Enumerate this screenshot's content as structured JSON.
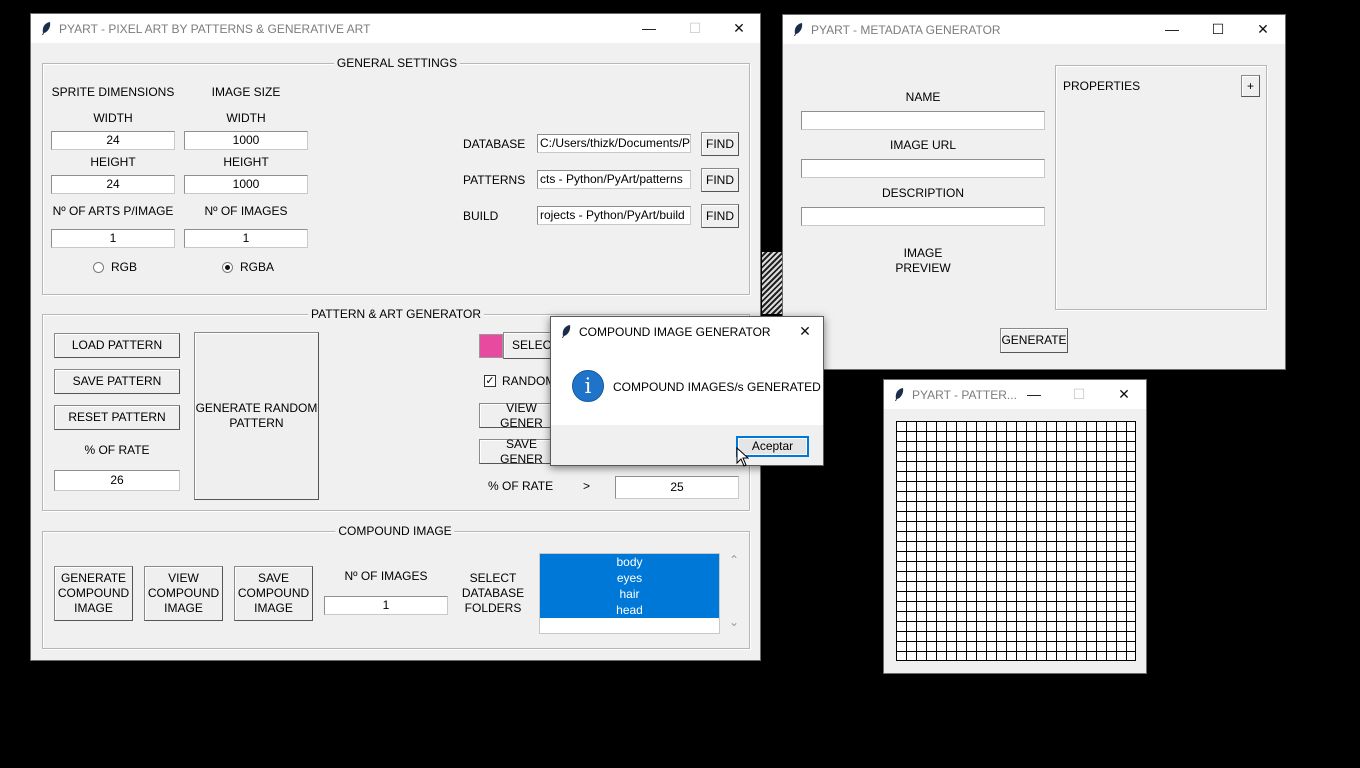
{
  "main_window": {
    "title": "PYART - PIXEL ART BY PATTERNS & GENERATIVE ART",
    "general_settings": {
      "legend": "GENERAL SETTINGS",
      "sprite_dimensions": "SPRITE DIMENSIONS",
      "image_size": "IMAGE SIZE",
      "width_label": "WIDTH",
      "height_label": "HEIGHT",
      "sprite_width": "24",
      "sprite_height": "24",
      "image_width": "1000",
      "image_height": "1000",
      "arts_per_image_label": "Nº OF ARTS P/IMAGE",
      "num_images_label": "Nº OF IMAGES",
      "arts_per_image": "1",
      "num_images": "1",
      "rgb_label": "RGB",
      "rgba_label": "RGBA",
      "selected_mode": "RGBA",
      "database_label": "DATABASE",
      "patterns_label": "PATTERNS",
      "build_label": "BUILD",
      "database_path": "C:/Users/thizk/Documents/P",
      "patterns_path": "cts - Python/PyArt/patterns",
      "build_path": "rojects - Python/PyArt/build",
      "find_label": "FIND"
    },
    "pattern_generator": {
      "legend": "PATTERN & ART GENERATOR",
      "load_pattern": "LOAD PATTERN",
      "save_pattern": "SAVE PATTERN",
      "reset_pattern": "RESET PATTERN",
      "rate_label": "% OF RATE",
      "rate_value": "26",
      "generate_random": "GENERATE RANDOM\nPATTERN",
      "color_swatch": "#e84aa0",
      "select_label": "SELECT",
      "random_label": "RANDOM",
      "random_checked": true,
      "view_gener": "VIEW GENER",
      "save_gener": "SAVE GENER",
      "rate_label_2": "% OF RATE",
      "gt_symbol": ">",
      "rate_value_2": "25"
    },
    "compound_image": {
      "legend": "COMPOUND IMAGE",
      "generate": "GENERATE\nCOMPOUND\nIMAGE",
      "view": "VIEW\nCOMPOUND\nIMAGE",
      "save": "SAVE\nCOMPOUND\nIMAGE",
      "num_images_label": "Nº OF IMAGES",
      "num_images": "1",
      "select_folders_label": "SELECT\nDATABASE\nFOLDERS",
      "folders": [
        "body",
        "eyes",
        "hair",
        "head"
      ],
      "scroll_up": "⌃",
      "scroll_down": "⌄"
    }
  },
  "metadata_window": {
    "title": "PYART - METADATA GENERATOR",
    "name_label": "NAME",
    "name_value": "",
    "image_url_label": "IMAGE URL",
    "image_url_value": "",
    "description_label": "DESCRIPTION",
    "description_value": "",
    "image_preview_label": "IMAGE\nPREVIEW",
    "properties_label": "PROPERTIES",
    "add_property": "+",
    "generate": "GENERATE"
  },
  "pattern_window": {
    "title": "PYART - PATTER..."
  },
  "dialog": {
    "title": "COMPOUND IMAGE GENERATOR",
    "icon_glyph": "i",
    "message": "COMPOUND IMAGES/s GENERATED",
    "ok_button": "Aceptar"
  },
  "window_controls": {
    "minimize": "—",
    "maximize": "☐",
    "close": "✕"
  },
  "colors": {
    "accent": "#0078d7",
    "swatch": "#e84aa0"
  }
}
